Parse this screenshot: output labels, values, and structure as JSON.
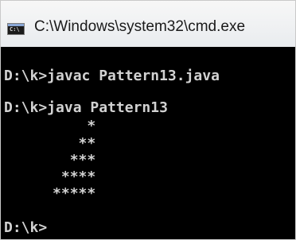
{
  "window": {
    "title": "C:\\Windows\\system32\\cmd.exe",
    "icon": "cmd-icon",
    "icon_text": "C:\\"
  },
  "console": {
    "lines": [
      "D:\\k>javac Pattern13.java",
      "D:\\k>java Pattern13",
      "D:\\k>"
    ],
    "pattern": [
      "          *",
      "         **",
      "        ***",
      "       ****",
      "      *****"
    ]
  }
}
